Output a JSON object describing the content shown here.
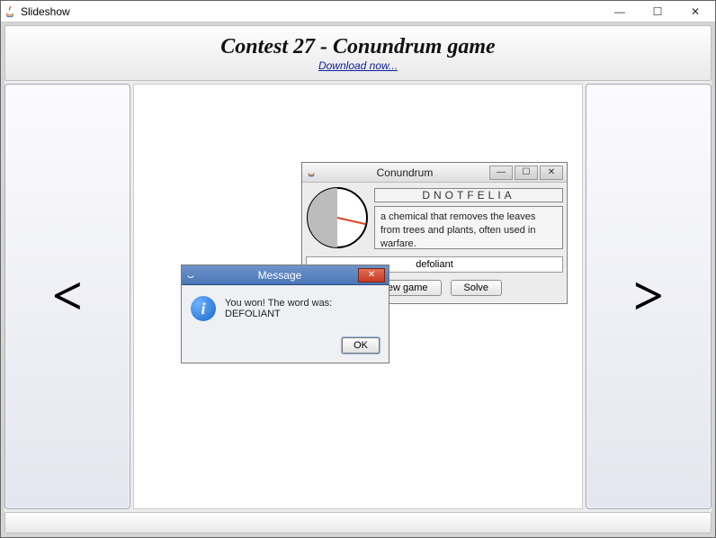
{
  "window": {
    "title": "Slideshow",
    "icon": "java-icon",
    "controls": {
      "minimize": "—",
      "maximize": "☐",
      "close": "✕"
    }
  },
  "header": {
    "title": "Contest 27 - Conundrum game",
    "download_link": "Download now..."
  },
  "nav": {
    "prev_glyph": "<",
    "next_glyph": ">"
  },
  "conundrum_window": {
    "title": "Conundrum",
    "controls": {
      "minimize": "—",
      "maximize": "☐",
      "close": "✕"
    },
    "anagram": "DNOTFELIA",
    "clue": "a chemical that removes the leaves from trees and plants, often used in warfare.",
    "answer_value": "defoliant",
    "buttons": {
      "new_game": "New game",
      "solve": "Solve"
    },
    "timer": {
      "fraction_elapsed": 0.5
    }
  },
  "message_dialog": {
    "title": "Message",
    "close": "✕",
    "icon": "info-icon",
    "text": "You won! The word was: DEFOLIANT",
    "ok": "OK"
  }
}
